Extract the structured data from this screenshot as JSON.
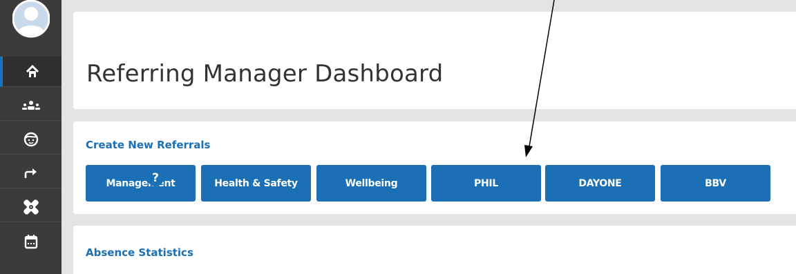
{
  "header": {
    "title": "Referring Manager Dashboard"
  },
  "create_referrals": {
    "heading": "Create New Referrals",
    "buttons": [
      "Management",
      "Health & Safety",
      "Wellbeing",
      "PHIL",
      "DAYONE",
      "BBV"
    ]
  },
  "absence": {
    "heading": "Absence Statistics",
    "help_symbol": "?"
  },
  "sidebar": {
    "items": [
      {
        "icon": "home-icon",
        "active": true
      },
      {
        "icon": "team-icon"
      },
      {
        "icon": "face-icon"
      },
      {
        "icon": "share-arrow-icon"
      },
      {
        "icon": "bandage-icon"
      },
      {
        "icon": "calendar-icon"
      }
    ]
  },
  "colors": {
    "accent": "#1a6fb5",
    "sidebar": "#3b3b3b",
    "background": "#e4e4e4"
  }
}
